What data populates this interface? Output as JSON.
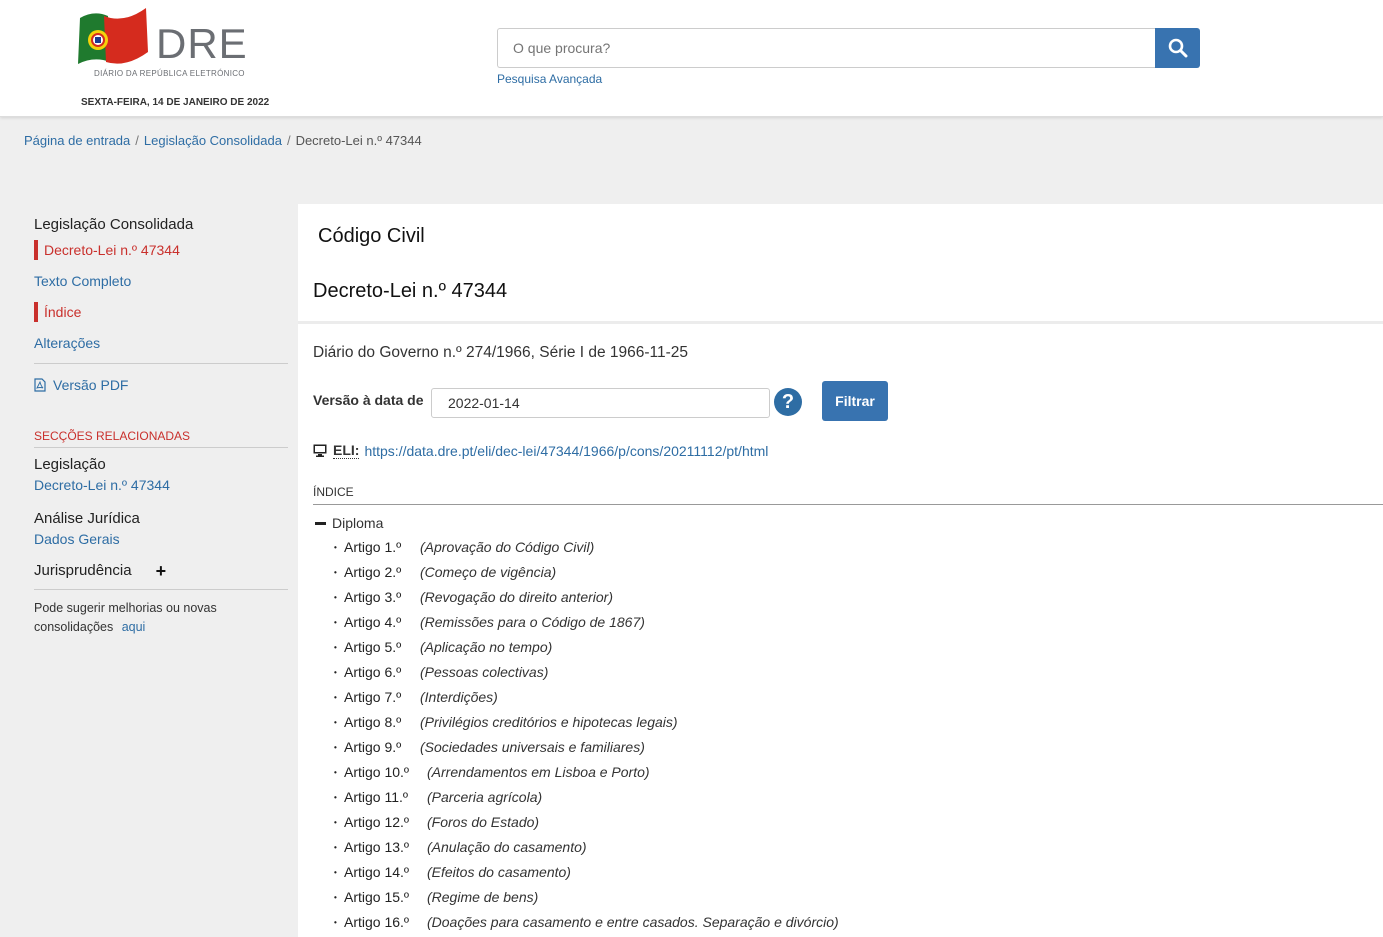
{
  "header": {
    "logo_text": "DRE",
    "logo_subtitle": "DIÁRIO DA REPÚBLICA ELETRÓNICO",
    "date": "SEXTA-FEIRA, 14 DE JANEIRO DE 2022",
    "search_placeholder": "O que procura?",
    "advanced_search": "Pesquisa Avançada"
  },
  "breadcrumb": [
    "Página de entrada",
    "Legislação Consolidada",
    "Decreto-Lei n.º 47344"
  ],
  "sidebar": {
    "title": "Legislação Consolidada",
    "items": [
      "Decreto-Lei n.º 47344",
      "Texto Completo",
      "Índice",
      "Alterações"
    ],
    "pdf": "Versão PDF",
    "related_heading": "SECÇÕES RELACIONADAS",
    "legislation_title": "Legislação",
    "legislation_link": "Decreto-Lei n.º 47344",
    "analysis_title": "Análise Jurídica",
    "analysis_link": "Dados Gerais",
    "jurisprudence_title": "Jurisprudência",
    "suggest_text": "Pode sugerir melhorias ou novas consolidações",
    "suggest_link": "aqui"
  },
  "main": {
    "code_title": "Código Civil",
    "decree_title": "Decreto-Lei n.º 47344",
    "gazette": "Diário do Governo n.º 274/1966, Série I de 1966-11-25",
    "version_label": "Versão à data de",
    "version_value": "2022-01-14",
    "help": "?",
    "filter_button": "Filtrar",
    "eli_label": "ELI:",
    "eli_url": "https://data.dre.pt/eli/dec-lei/47344/1966/p/cons/20211112/pt/html",
    "index_label": "ÍNDICE",
    "diploma_label": "Diploma",
    "articles": [
      {
        "art": "Artigo 1.º",
        "desc": "(Aprovação do Código Civil)"
      },
      {
        "art": "Artigo 2.º",
        "desc": "(Começo de vigência)"
      },
      {
        "art": "Artigo 3.º",
        "desc": "(Revogação do direito anterior)"
      },
      {
        "art": "Artigo 4.º",
        "desc": "(Remissões para o Código de 1867)"
      },
      {
        "art": "Artigo 5.º",
        "desc": "(Aplicação no tempo)"
      },
      {
        "art": "Artigo 6.º",
        "desc": "(Pessoas colectivas)"
      },
      {
        "art": "Artigo 7.º",
        "desc": "(Interdições)"
      },
      {
        "art": "Artigo 8.º",
        "desc": "(Privilégios creditórios e hipotecas legais)"
      },
      {
        "art": "Artigo 9.º",
        "desc": "(Sociedades universais e familiares)"
      },
      {
        "art": "Artigo 10.º",
        "desc": "(Arrendamentos em Lisboa e Porto)"
      },
      {
        "art": "Artigo 11.º",
        "desc": "(Parceria agrícola)"
      },
      {
        "art": "Artigo 12.º",
        "desc": "(Foros do Estado)"
      },
      {
        "art": "Artigo 13.º",
        "desc": "(Anulação do casamento)"
      },
      {
        "art": "Artigo 14.º",
        "desc": "(Efeitos do casamento)"
      },
      {
        "art": "Artigo 15.º",
        "desc": "(Regime de bens)"
      },
      {
        "art": "Artigo 16.º",
        "desc": "(Doações para casamento e entre casados. Separação e divórcio)"
      }
    ]
  },
  "colors": {
    "accent_blue": "#3873b0",
    "link_blue": "#2e6da4",
    "active_red": "#c9302c"
  }
}
